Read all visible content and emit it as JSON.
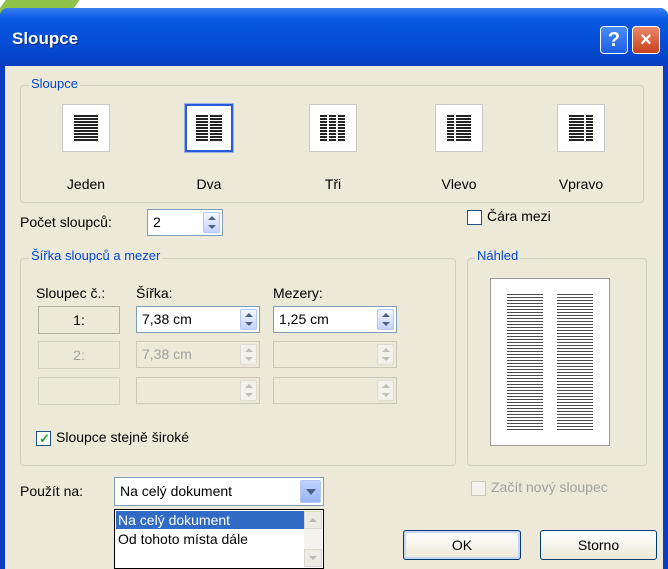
{
  "dialog": {
    "title": "Sloupce",
    "help_button": "?",
    "close_button": "×"
  },
  "presets": {
    "legend": "Sloupce",
    "items": [
      {
        "label": "Jeden",
        "selected": false
      },
      {
        "label": "Dva",
        "selected": true
      },
      {
        "label": "Tři",
        "selected": false
      },
      {
        "label": "Vlevo",
        "selected": false
      },
      {
        "label": "Vpravo",
        "selected": false
      }
    ]
  },
  "count": {
    "label": "Počet sloupců:",
    "value": "2"
  },
  "separator": {
    "label": "Čára mezi",
    "checked": false
  },
  "widths": {
    "legend": "Šířka sloupců a mezer",
    "col_header": "Sloupec č.:",
    "width_header": "Šířka:",
    "spacing_header": "Mezery:",
    "rows": [
      {
        "num": "1:",
        "width": "7,38 cm",
        "spacing": "1,25 cm",
        "enabled": true
      },
      {
        "num": "2:",
        "width": "7,38 cm",
        "spacing": "",
        "enabled": false
      },
      {
        "num": "",
        "width": "",
        "spacing": "",
        "enabled": false
      }
    ],
    "equal_width": {
      "label": "Sloupce stejně široké",
      "checked": true
    }
  },
  "preview": {
    "legend": "Náhled"
  },
  "apply": {
    "label": "Použít na:",
    "selected": "Na celý dokument",
    "options": [
      "Na celý dokument",
      "Od tohoto místa dále"
    ]
  },
  "new_column": {
    "label": "Začít nový sloupec",
    "checked": false,
    "enabled": false
  },
  "buttons": {
    "ok": "OK",
    "cancel": "Storno"
  },
  "colors": {
    "title_bar": "#0550d8",
    "dialog_bg": "#ece9d8",
    "accent": "#0046d5",
    "selection": "#316ac5",
    "check": "#21a121"
  }
}
